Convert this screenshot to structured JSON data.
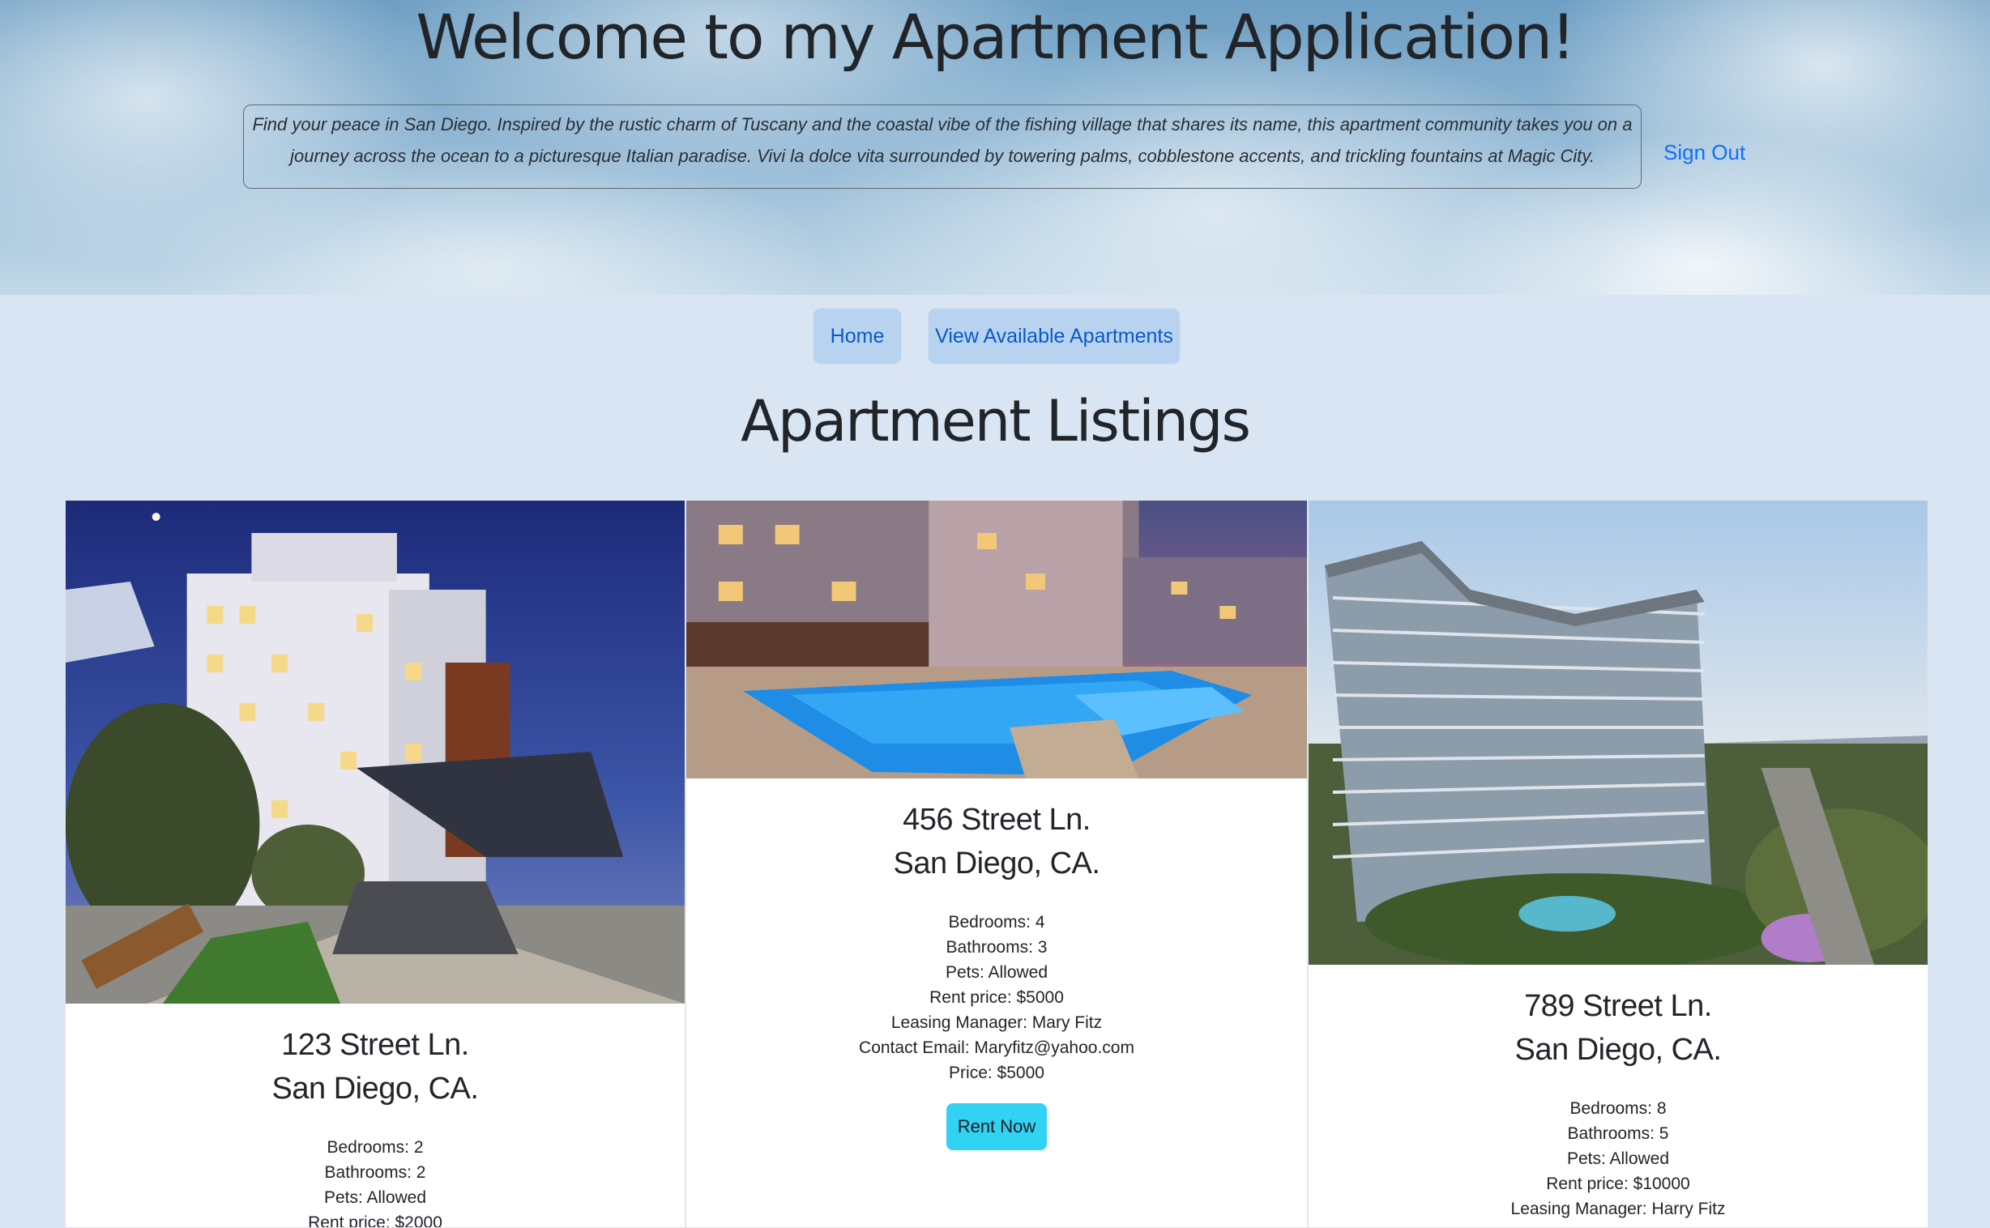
{
  "header": {
    "title": "Welcome to my Apartment Application!",
    "description": "Find your peace in San Diego. Inspired by the rustic charm of Tuscany and the coastal vibe of the fishing village that shares its name, this apartment community takes you on a journey across the ocean to a picturesque Italian paradise. Vivi la dolce vita surrounded by towering palms, cobblestone accents, and trickling fountains at Magic City.",
    "sign_out": "Sign Out"
  },
  "nav": {
    "home": "Home",
    "view_available": "View Available Apartments"
  },
  "listings_title": "Apartment Listings",
  "listings": [
    {
      "street": "123 Street Ln.",
      "city": "San Diego, CA.",
      "bedrooms": "Bedrooms: 2",
      "bathrooms": "Bathrooms: 2",
      "pets": "Pets: Allowed",
      "rent_price": "Rent price: $2000"
    },
    {
      "street": "456 Street Ln.",
      "city": "San Diego, CA.",
      "bedrooms": "Bedrooms: 4",
      "bathrooms": "Bathrooms: 3",
      "pets": "Pets: Allowed",
      "rent_price": "Rent price: $5000",
      "manager": "Leasing Manager: Mary Fitz",
      "email": "Contact Email: Maryfitz@yahoo.com",
      "price": "Price: $5000",
      "rent_button": "Rent Now"
    },
    {
      "street": "789 Street Ln.",
      "city": "San Diego, CA.",
      "bedrooms": "Bedrooms: 8",
      "bathrooms": "Bathrooms: 5",
      "pets": "Pets: Allowed",
      "rent_price": "Rent price: $10000",
      "manager": "Leasing Manager: Harry Fitz"
    }
  ],
  "colors": {
    "page_background": "#dae5f3",
    "nav_button": "#b7d3ef",
    "link": "#0d6efd",
    "rent_button": "#31d2f2"
  }
}
